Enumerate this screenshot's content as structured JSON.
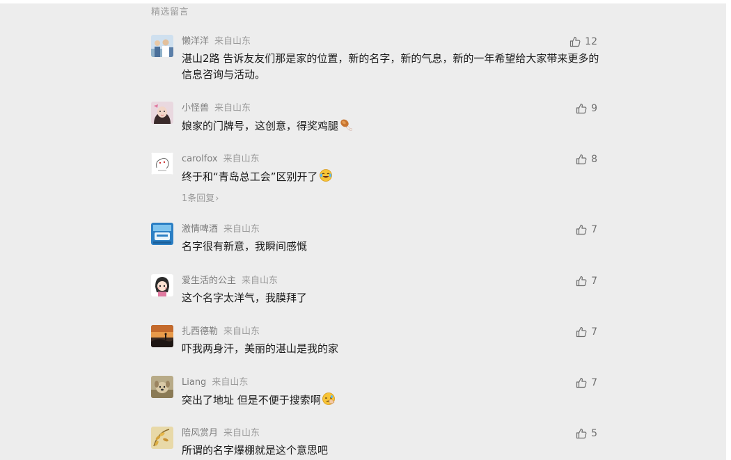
{
  "section_title": "精选留言",
  "comments": [
    {
      "nickname": "懒洋洋",
      "location": "来自山东",
      "likes": "12",
      "text": "湛山2路 告诉友友们那是家的位置，新的名字，新的气息，新的一年希望给大家带来更多的信息咨询与活动。",
      "avatar": "group-photo-avatar"
    },
    {
      "nickname": "小怪兽",
      "location": "来自山东",
      "likes": "9",
      "text": "娘家的门牌号，这创意，得奖鸡腿",
      "emoji": "drumstick-icon",
      "avatar": "girl-photo-avatar"
    },
    {
      "nickname": "carolfox",
      "location": "来自山东",
      "likes": "8",
      "text": "终于和“青岛总工会”区别开了",
      "emoji": "laugh-cry-icon",
      "reply": "1条回复",
      "avatar": "sketch-avatar"
    },
    {
      "nickname": "激情啤酒",
      "location": "来自山东",
      "likes": "7",
      "text": "名字很有新意，我瞬间感慨",
      "avatar": "beer-logo-avatar"
    },
    {
      "nickname": "爱生活的公主",
      "location": "来自山东",
      "likes": "7",
      "text": "这个名字太洋气，我膜拜了",
      "avatar": "cartoon-girl-avatar"
    },
    {
      "nickname": "扎西德勒",
      "location": "来自山东",
      "likes": "7",
      "text": "吓我两身汗，美丽的湛山是我的家",
      "avatar": "sunset-avatar"
    },
    {
      "nickname": "Liang",
      "location": "来自山东",
      "likes": "7",
      "text": "突出了地址 但是不便于搜索啊",
      "emoji": "facepalm-icon",
      "avatar": "dog-photo-avatar"
    },
    {
      "nickname": "陪风赏月",
      "location": "来自山东",
      "likes": "5",
      "text": "所谓的名字爆棚就是这个意思吧",
      "avatar": "gold-leaves-avatar"
    }
  ]
}
